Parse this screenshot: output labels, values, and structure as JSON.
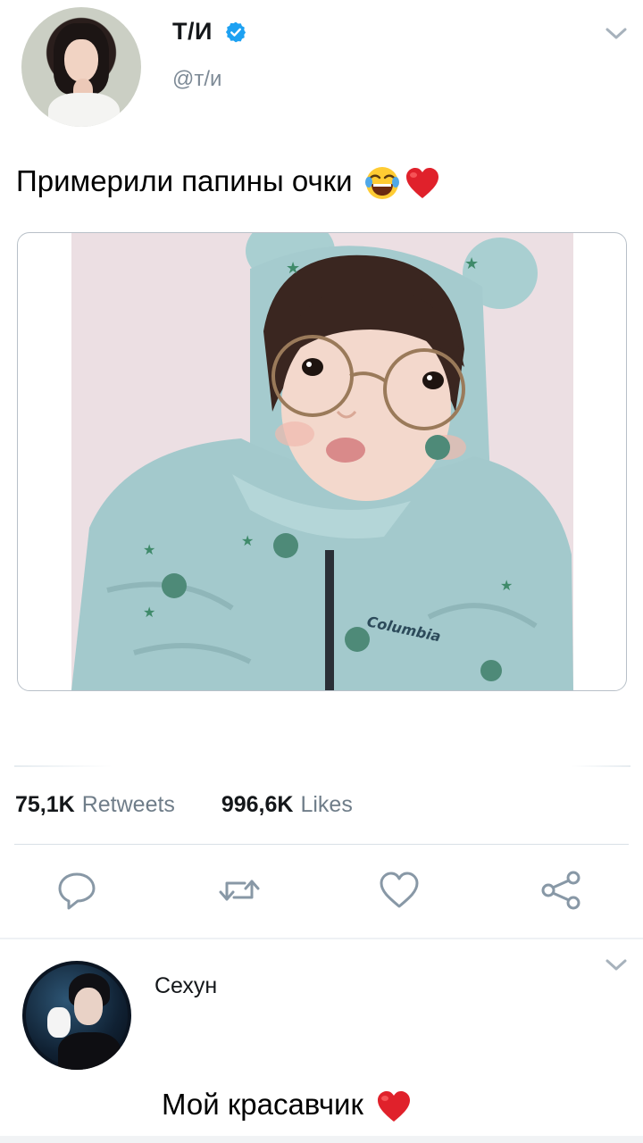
{
  "tweet": {
    "author_name": "Т/И",
    "handle": "@т/и",
    "verified": true,
    "text": "Примерили папины очки",
    "emojis": [
      "tears-of-joy-emoji",
      "red-heart-emoji"
    ],
    "media": {
      "brand_text": "Columbia"
    }
  },
  "stats": {
    "retweets_count": "75,1K",
    "retweets_label": "Retweets",
    "likes_count": "996,6K",
    "likes_label": "Likes"
  },
  "actions": [
    {
      "icon": "reply-icon"
    },
    {
      "icon": "retweet-icon"
    },
    {
      "icon": "like-heart-icon"
    },
    {
      "icon": "share-icon"
    }
  ],
  "reply": {
    "author_name": "Сехун",
    "text": "Мой красавчик",
    "emojis": [
      "red-heart-emoji"
    ]
  },
  "colors": {
    "verified_blue": "#1da1f2",
    "icon_gray": "#8898a6",
    "heart_red": "#e0212b",
    "text_primary": "#14171a",
    "text_secondary": "#6f7d89"
  }
}
